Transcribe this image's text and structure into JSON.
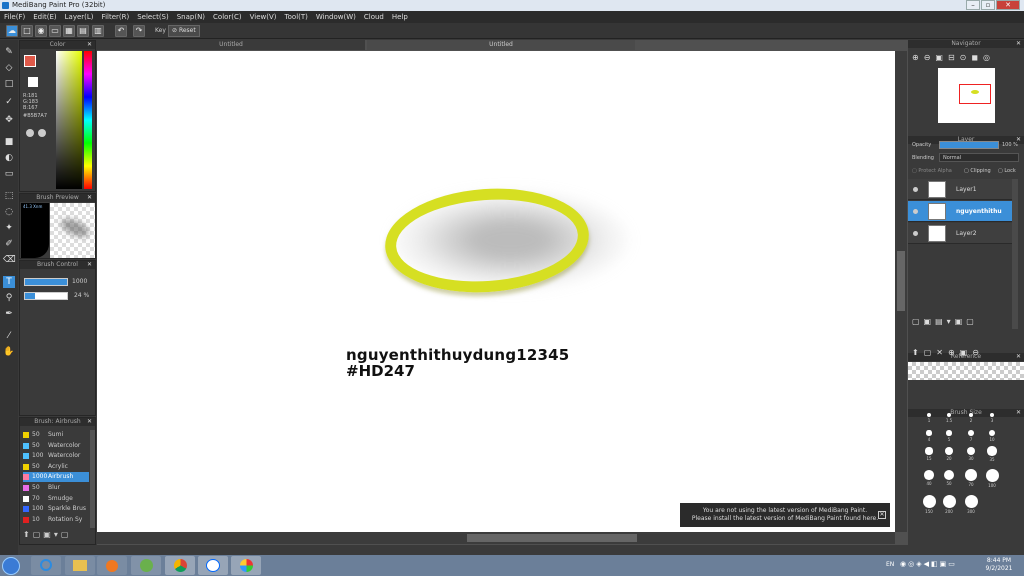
{
  "window": {
    "title": "MediBang Paint Pro (32bit)",
    "min": "–",
    "max": "▫",
    "close": "✕"
  },
  "menu": [
    "File(F)",
    "Edit(E)",
    "Layer(L)",
    "Filter(R)",
    "Select(S)",
    "Snap(N)",
    "Color(C)",
    "View(V)",
    "Tool(T)",
    "Window(W)",
    "Cloud",
    "Help"
  ],
  "toolbar": {
    "key_label": "Key",
    "reset_label": "Reset"
  },
  "tabs": [
    "Untitled",
    "Untitled"
  ],
  "color_panel": {
    "title": "Color",
    "r": "R:181",
    "g": "G:183",
    "b": "B:167",
    "hex": "#B5B7A7"
  },
  "brush_preview": {
    "title": "Brush Preview",
    "size": "41.3 Xnm"
  },
  "brush_control": {
    "title": "Brush Control",
    "size_value": "1000",
    "opacity_value": "24 %"
  },
  "brush_list": {
    "title": "Brush: Airbrush",
    "items": [
      {
        "size": "50",
        "name": "Sumi",
        "color": "#f0d000"
      },
      {
        "size": "50",
        "name": "Watercolor",
        "color": "#4ec1ff"
      },
      {
        "size": "100",
        "name": "Watercolor",
        "color": "#4ec1ff"
      },
      {
        "size": "50",
        "name": "Acrylic",
        "color": "#f0d000"
      },
      {
        "size": "1000",
        "name": "Airbrush",
        "color": "#ff7aa2",
        "selected": true
      },
      {
        "size": "50",
        "name": "Blur",
        "color": "#e86de8"
      },
      {
        "size": "70",
        "name": "Smudge",
        "color": "#ffffff"
      },
      {
        "size": "100",
        "name": "Sparkle Brus",
        "color": "#3366ff"
      },
      {
        "size": "10",
        "name": "Rotation Sy",
        "color": "#e02020"
      }
    ]
  },
  "canvas": {
    "signature_line1": "nguyenthithuydung12345",
    "signature_line2": "#HD247"
  },
  "notice": {
    "line1": "You are not using the latest version of MediBang Paint.",
    "line2": "Please install the latest version of MediBang Paint found here.",
    "close": "✕"
  },
  "navigator": {
    "title": "Navigator"
  },
  "layer_panel": {
    "title": "Layer",
    "opacity_label": "Opacity",
    "opacity_value": "100 %",
    "opacity": 1.0,
    "blending_label": "Blending",
    "blending_value": "Normal",
    "protect_alpha": "Protect Alpha",
    "clipping": "Clipping",
    "lock": "Lock",
    "layers": [
      {
        "name": "Layer1"
      },
      {
        "name": "nguyenthithu",
        "selected": true
      },
      {
        "name": "Layer2"
      }
    ]
  },
  "reference": {
    "title": "Reference"
  },
  "brush_size": {
    "title": "Brush Size",
    "labels": [
      "1",
      "1.5",
      "2",
      "3",
      "4",
      "5",
      "7",
      "10",
      "15",
      "20",
      "30",
      "35",
      "40",
      "50",
      "70",
      "100",
      "150",
      "200",
      "300"
    ]
  },
  "taskbar": {
    "lang": "EN",
    "time": "8:44 PM",
    "date": "9/2/2021"
  }
}
